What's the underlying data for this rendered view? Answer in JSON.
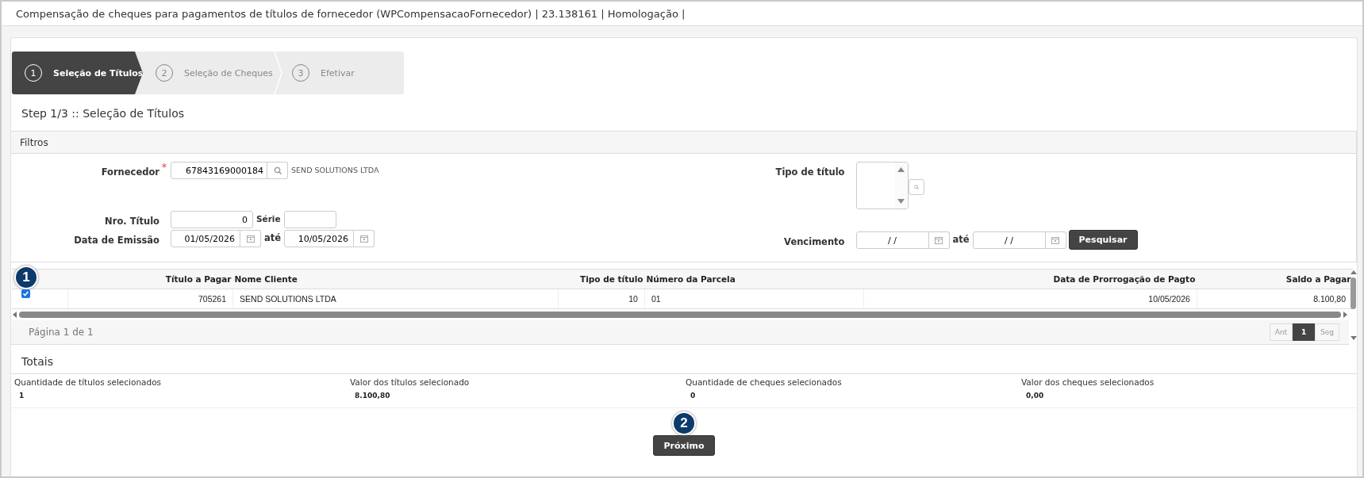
{
  "window": {
    "title": "Compensação de cheques para pagamentos de títulos de fornecedor (WPCompensacaoFornecedor) | 23.138161 | Homologação |"
  },
  "wizard": {
    "steps": [
      {
        "number": "1",
        "label": "Seleção de Títulos",
        "selected": true
      },
      {
        "number": "2",
        "label": "Seleção de Cheques",
        "selected": false
      },
      {
        "number": "3",
        "label": "Efetivar",
        "selected": false
      }
    ]
  },
  "step_heading": "Step 1/3 :: Seleção de Títulos",
  "filters": {
    "title": "Filtros",
    "fornecedor": {
      "label": "Fornecedor",
      "required_mark": "*",
      "value": "67843169000184",
      "name": "SEND SOLUTIONS LTDA"
    },
    "nro_titulo": {
      "label": "Nro. Título",
      "value": "0"
    },
    "serie": {
      "label": "Série"
    },
    "data_emissao": {
      "label": "Data de Emissão",
      "from": "01/05/2026",
      "to_label": "até",
      "to": "10/05/2026"
    },
    "tipo_titulo": {
      "label": "Tipo de título"
    },
    "vencimento": {
      "label": "Vencimento",
      "from": "/ /",
      "to_label": "até",
      "to": "/ /"
    },
    "search_button": "Pesquisar"
  },
  "table": {
    "columns": [
      "Título a Pagar",
      "Nome Cliente",
      "Tipo de título",
      "Número da Parcela",
      "Data de Prorrogação de Pagto",
      "Saldo a Pagar"
    ],
    "rows": [
      {
        "checked": true,
        "cells": [
          "705261",
          "SEND SOLUTIONS LTDA",
          "10",
          "01",
          "10/05/2026",
          "8.100,80"
        ]
      }
    ]
  },
  "pagination": {
    "info": "Página 1 de 1",
    "buttons": [
      {
        "label": "Ant",
        "selected": false
      },
      {
        "label": "1",
        "selected": true
      },
      {
        "label": "Seg",
        "selected": false
      }
    ]
  },
  "totals": {
    "title": "Totais",
    "items": [
      {
        "label": "Quantidade de títulos selecionados",
        "value": "1"
      },
      {
        "label": "Valor dos títulos selecionado",
        "value": "8.100,80"
      },
      {
        "label": "Quantidade de cheques selecionados",
        "value": "0"
      },
      {
        "label": "Valor dos cheques selecionados",
        "value": "0,00"
      }
    ]
  },
  "next_button": "Próximo",
  "callouts": [
    "1",
    "2"
  ]
}
